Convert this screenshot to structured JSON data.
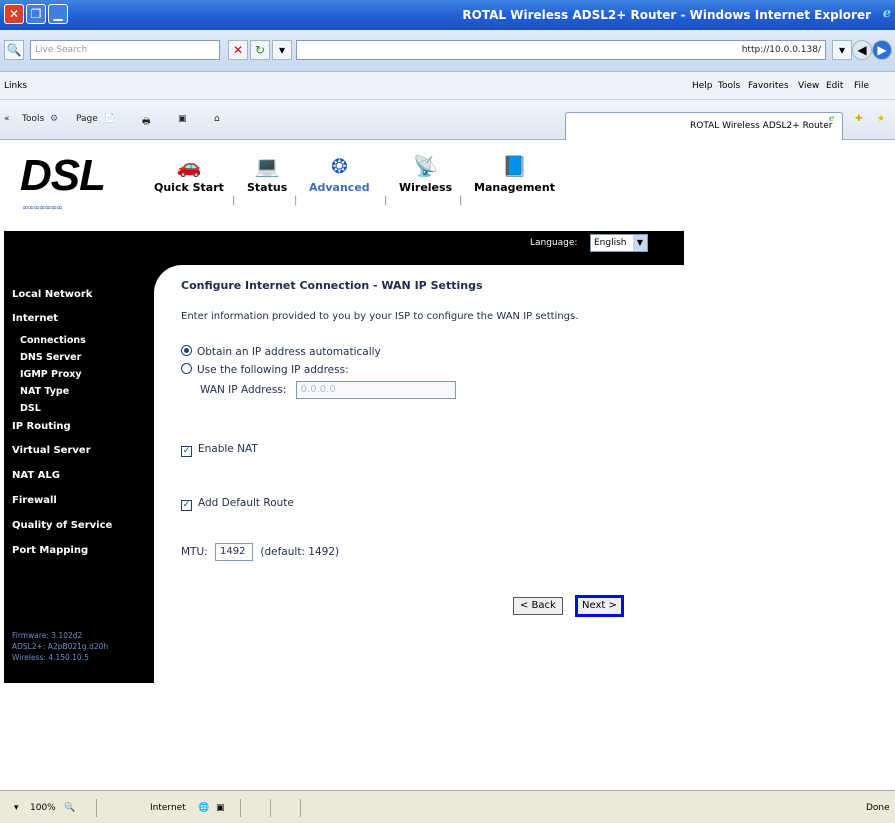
{
  "window": {
    "title": "ROTAL Wireless ADSL2+ Router - Windows Internet Explorer"
  },
  "addressbar": {
    "live_search_placeholder": "Live Search",
    "url": "http://10.0.0.138/"
  },
  "linksbar": {
    "links_label": "Links",
    "menu": [
      "Help",
      "Tools",
      "Favorites",
      "View",
      "Edit",
      "File"
    ]
  },
  "commandbar": {
    "tools_label": "Tools",
    "page_label": "Page",
    "tab_title": "ROTAL Wireless ADSL2+ Router"
  },
  "router": {
    "logo_text": "DSL",
    "nav": [
      {
        "label": "Quick Start",
        "icon": "car-icon"
      },
      {
        "label": "Status",
        "icon": "laptop-icon"
      },
      {
        "label": "Advanced",
        "icon": "globe-icon"
      },
      {
        "label": "Wireless",
        "icon": "antenna-icon"
      },
      {
        "label": "Management",
        "icon": "book-icon"
      }
    ],
    "active_nav": "Advanced",
    "language_label": "Language:",
    "language_value": "English",
    "sidebar": [
      {
        "label": "Local Network"
      },
      {
        "label": "Internet"
      },
      {
        "label": "Connections"
      },
      {
        "label": "DNS Server"
      },
      {
        "label": "IGMP Proxy"
      },
      {
        "label": "NAT Type"
      },
      {
        "label": "DSL"
      },
      {
        "label": "IP Routing"
      },
      {
        "label": "Virtual Server"
      },
      {
        "label": "NAT ALG"
      },
      {
        "label": "Firewall"
      },
      {
        "label": "Quality of Service"
      },
      {
        "label": "Port Mapping"
      }
    ],
    "firmware": {
      "firmware_line": "Firmware: 3.102d2",
      "adsl_line": "ADSL2+: A2pB021g.d20h",
      "wireless_line": "Wireless: 4.150.10.5"
    }
  },
  "form": {
    "heading": "Configure Internet Connection - WAN IP Settings",
    "description": "Enter information provided to you by your ISP to configure the WAN IP settings.",
    "option_auto": "Obtain an IP address automatically",
    "option_manual": "Use the following IP address:",
    "ip_mode": "auto",
    "wan_ip_label": "WAN IP Address:",
    "wan_ip_value": "0.0.0.0",
    "enable_nat_label": "Enable NAT",
    "enable_nat_checked": true,
    "default_route_label": "Add Default Route",
    "default_route_checked": true,
    "mtu_label": "MTU:",
    "mtu_value": "1492",
    "mtu_default": "(default: 1492)",
    "back_button": "< Back",
    "next_button": "Next >"
  },
  "statusbar": {
    "zoom": "100%",
    "zone": "Internet",
    "status": "Done"
  },
  "colors": {
    "titlebar": "#2563d6",
    "next_highlight": "#0010d8",
    "nav_active": "#3c6fb8"
  }
}
